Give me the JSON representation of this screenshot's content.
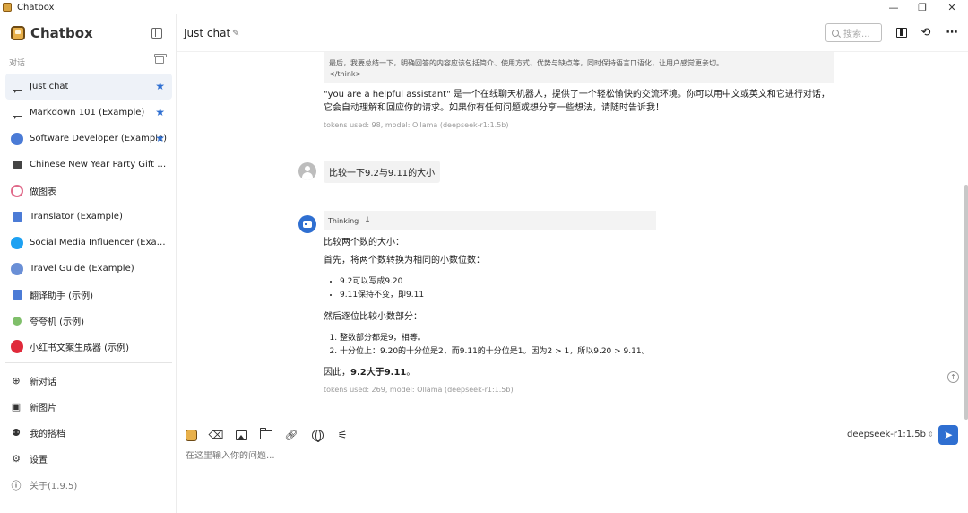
{
  "window": {
    "title": "Chatbox",
    "controls": {
      "minimize": "—",
      "maximize": "❐",
      "close": "✕"
    }
  },
  "sidebar": {
    "brand": "Chatbox",
    "section_label": "对话",
    "sessions": [
      {
        "label": "Just chat",
        "starred": true,
        "active": true,
        "icon": "chat-bubble-icon"
      },
      {
        "label": "Markdown 101 (Example)",
        "starred": true,
        "icon": "chat-bubble-icon"
      },
      {
        "label": "Software Developer (Example)",
        "starred": true,
        "icon": "developer-avatar",
        "color": "#4b7bd6"
      },
      {
        "label": "Chinese New Year Party Gift Exc...",
        "icon": "gift-avatar",
        "color": "#444444"
      },
      {
        "label": "做图表",
        "icon": "chart-avatar",
        "color": "#e06a8a"
      },
      {
        "label": "Translator (Example)",
        "icon": "translator-avatar",
        "color": "#4b7bd6"
      },
      {
        "label": "Social Media Influencer (Example)",
        "icon": "twitter-avatar",
        "color": "#1da1f2"
      },
      {
        "label": "Travel Guide (Example)",
        "icon": "globe-avatar",
        "color": "#6a8fd6"
      },
      {
        "label": "翻译助手 (示例)",
        "icon": "translate-avatar",
        "color": "#4b7bd6"
      },
      {
        "label": "夸夸机 (示例)",
        "icon": "praise-avatar",
        "color": "#7fbf6a"
      },
      {
        "label": "小红书文案生成器 (示例)",
        "icon": "xiaohongshu-avatar",
        "color": "#e02a3a"
      }
    ],
    "menu": [
      {
        "label": "新对话",
        "icon": "plus-circle-icon"
      },
      {
        "label": "新图片",
        "icon": "image-icon"
      },
      {
        "label": "我的搭档",
        "icon": "robot-icon"
      },
      {
        "label": "设置",
        "icon": "gear-icon"
      },
      {
        "label": "关于(1.9.5)",
        "icon": "info-icon"
      }
    ]
  },
  "header": {
    "title": "Just chat",
    "search_placeholder": "搜索..."
  },
  "messages": {
    "previous_think_line1": "最后，我要总结一下，明确回答的内容应该包括简介、使用方式、优势与缺点等，同时保持语言口语化，让用户感觉更亲切。",
    "previous_think_close": "</think>",
    "previous_answer": "\"you are a helpful assistant\" 是一个在线聊天机器人，提供了一个轻松愉快的交流环境。你可以用中文或英文和它进行对话，它会自动理解和回应你的请求。如果你有任何问题或想分享一些想法，请随时告诉我！",
    "previous_meta": "tokens used: 98, model: Ollama (deepseek-r1:1.5b)",
    "user_question": "比较一下9.2与9.11的大小",
    "thinking_label": "Thinking",
    "answer_heading": "比较两个数的大小：",
    "answer_step1": "首先，将两个数转换为相同的小数位数：",
    "bullets": [
      "9.2可以写成9.20",
      "9.11保持不变，即9.11"
    ],
    "answer_step2": "然后逐位比较小数部分：",
    "numbered": [
      "整数部分都是9，相等。",
      "十分位上：9.20的十分位是2，而9.11的十分位是1。因为2 > 1，所以9.20 > 9.11。"
    ],
    "conclusion_prefix": "因此，",
    "conclusion_bold": "9.2大于9.11",
    "conclusion_suffix": "。",
    "answer_meta": "tokens used: 269, model: Ollama (deepseek-r1:1.5b)"
  },
  "composer": {
    "model": "deepseek-r1:1.5b",
    "placeholder": "在这里输入你的问题..."
  }
}
